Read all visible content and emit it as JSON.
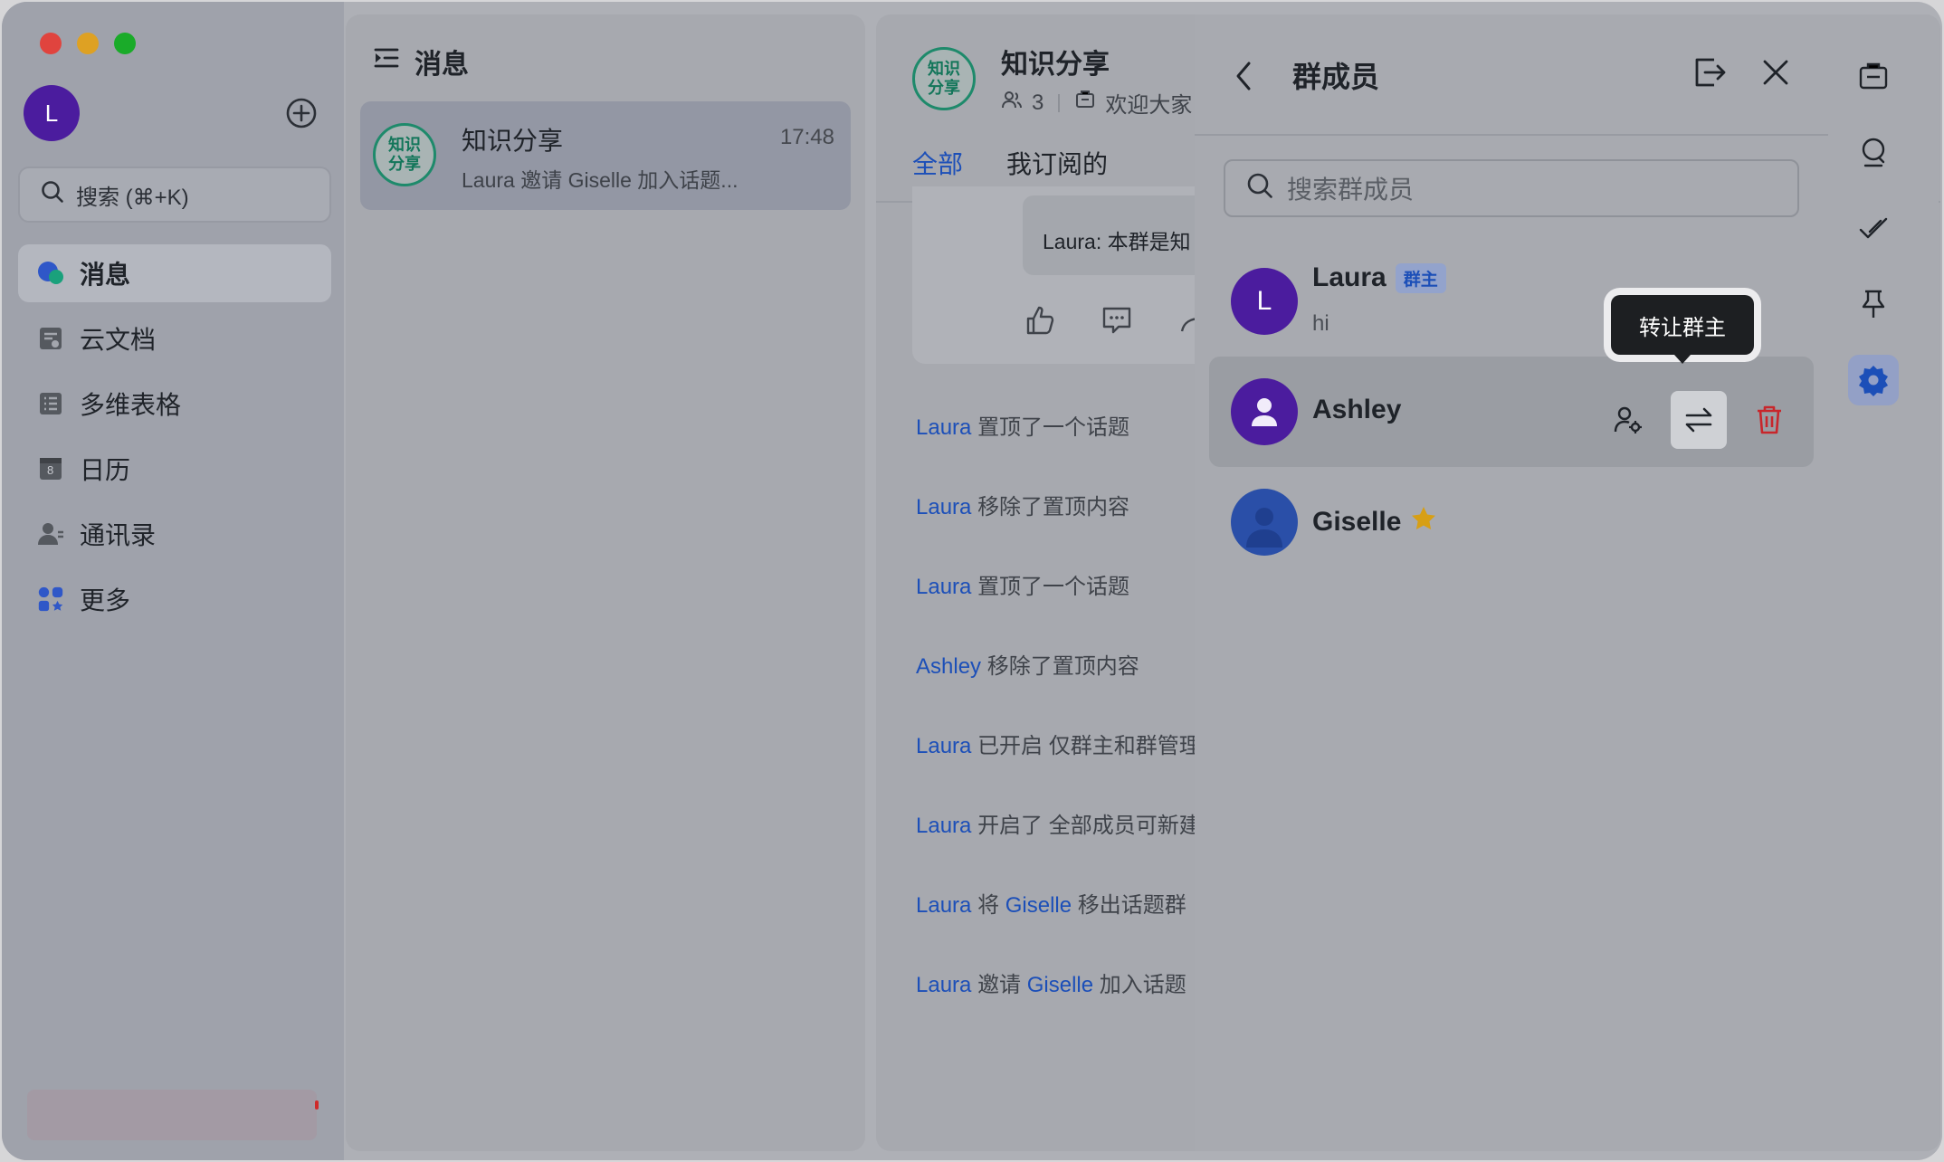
{
  "sidebar": {
    "avatar_letter": "L",
    "search_placeholder": "搜索 (⌘+K)",
    "items": [
      {
        "label": "消息",
        "icon": "messages-icon",
        "active": true
      },
      {
        "label": "云文档",
        "icon": "docs-icon"
      },
      {
        "label": "多维表格",
        "icon": "base-table-icon"
      },
      {
        "label": "日历",
        "icon": "calendar-icon"
      },
      {
        "label": "通讯录",
        "icon": "contacts-icon"
      },
      {
        "label": "更多",
        "icon": "more-apps-icon"
      }
    ],
    "calendar_day": "8"
  },
  "message_list": {
    "title": "消息",
    "chats": [
      {
        "avatar_text_1": "知识",
        "avatar_text_2": "分享",
        "name": "知识分享",
        "time": "17:48",
        "preview": "Laura 邀请 Giselle 加入话题..."
      }
    ]
  },
  "chat": {
    "avatar_text_1": "知识",
    "avatar_text_2": "分享",
    "name": "知识分享",
    "member_count": "3",
    "announcement": "欢迎大家",
    "tabs": [
      "全部",
      "我订阅的"
    ],
    "card_text": "Laura: 本群是知",
    "events": [
      {
        "user": "Laura",
        "text": "置顶了一个话题"
      },
      {
        "user": "Laura",
        "text": "移除了置顶内容"
      },
      {
        "user": "Laura",
        "text": "置顶了一个话题"
      },
      {
        "user": "Ashley",
        "text": "移除了置顶内容"
      },
      {
        "user": "Laura",
        "text": "已开启 仅群主和群管理"
      },
      {
        "user": "Laura",
        "text": "开启了 全部成员可新建"
      },
      {
        "user": "Laura",
        "text": "将",
        "target": "Giselle",
        "text2": "移出话题群"
      },
      {
        "user": "Laura",
        "text": "邀请",
        "target": "Giselle",
        "text2": "加入话题"
      }
    ]
  },
  "members_panel": {
    "title": "群成员",
    "search_placeholder": "搜索群成员",
    "members": [
      {
        "name": "Laura",
        "avatar_letter": "L",
        "badge": "群主",
        "status": "hi",
        "color": "#4b1c9e"
      },
      {
        "name": "Ashley",
        "color": "#4b1c9e"
      },
      {
        "name": "Giselle",
        "color": "#2a4fa8"
      }
    ],
    "tooltip": "转让群主"
  },
  "colors": {
    "accent": "#1c4fb8",
    "delete": "#c8262b",
    "star": "#d79f15",
    "group_green": "#1e8a6b"
  }
}
